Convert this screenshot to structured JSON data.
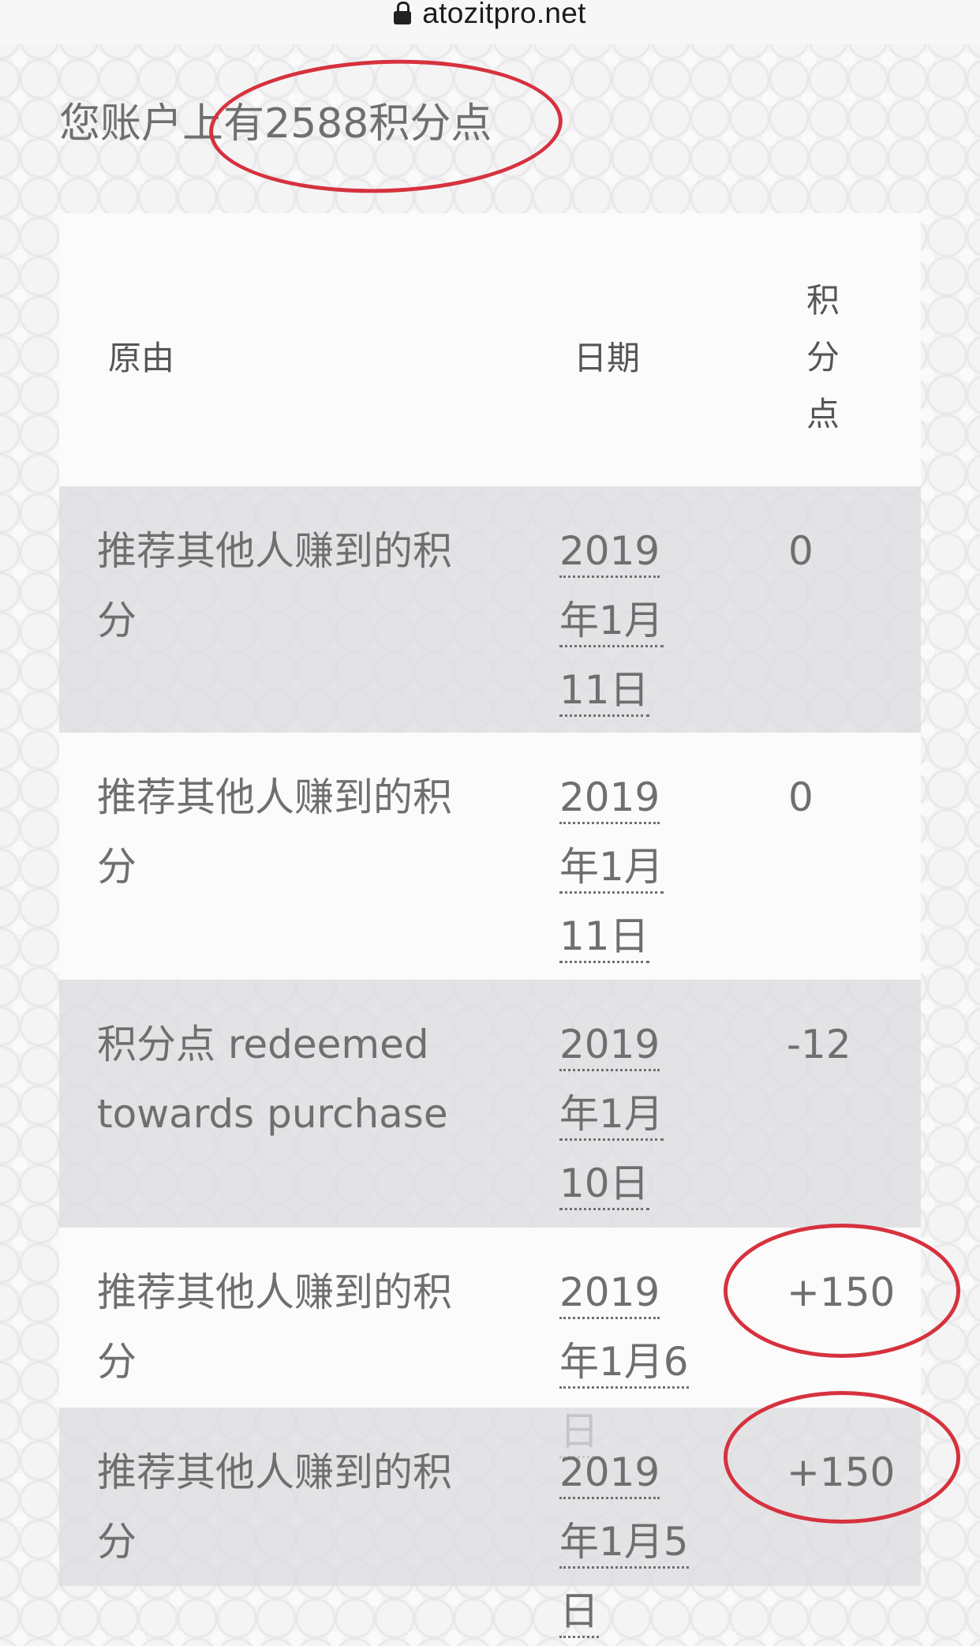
{
  "browser": {
    "url": "atozitpro.net"
  },
  "summary": {
    "text": "您账户上有2588积分点"
  },
  "table": {
    "headers": {
      "reason": "原由",
      "date": "日期",
      "points": "积分点"
    },
    "rows": [
      {
        "reason": "推荐其他人赚到的积分",
        "date": "2019年1月11日",
        "points": "0"
      },
      {
        "reason": "推荐其他人赚到的积分",
        "date": "2019年1月11日",
        "points": "0"
      },
      {
        "reason": "积分点 redeemed towards purchase",
        "date": "2019年1月10日",
        "points": "-12"
      },
      {
        "reason": "推荐其他人赚到的积分",
        "date": "2019年1月6日",
        "points": "+150"
      },
      {
        "reason": "推荐其他人赚到的积分",
        "date": "2019年1月5日",
        "points": "+150"
      }
    ]
  },
  "colors": {
    "annotation_red": "#d6323e",
    "text_gray": "#6f6f6f",
    "row_shaded": "#dedee1",
    "row_plain": "#fbfbfb"
  }
}
